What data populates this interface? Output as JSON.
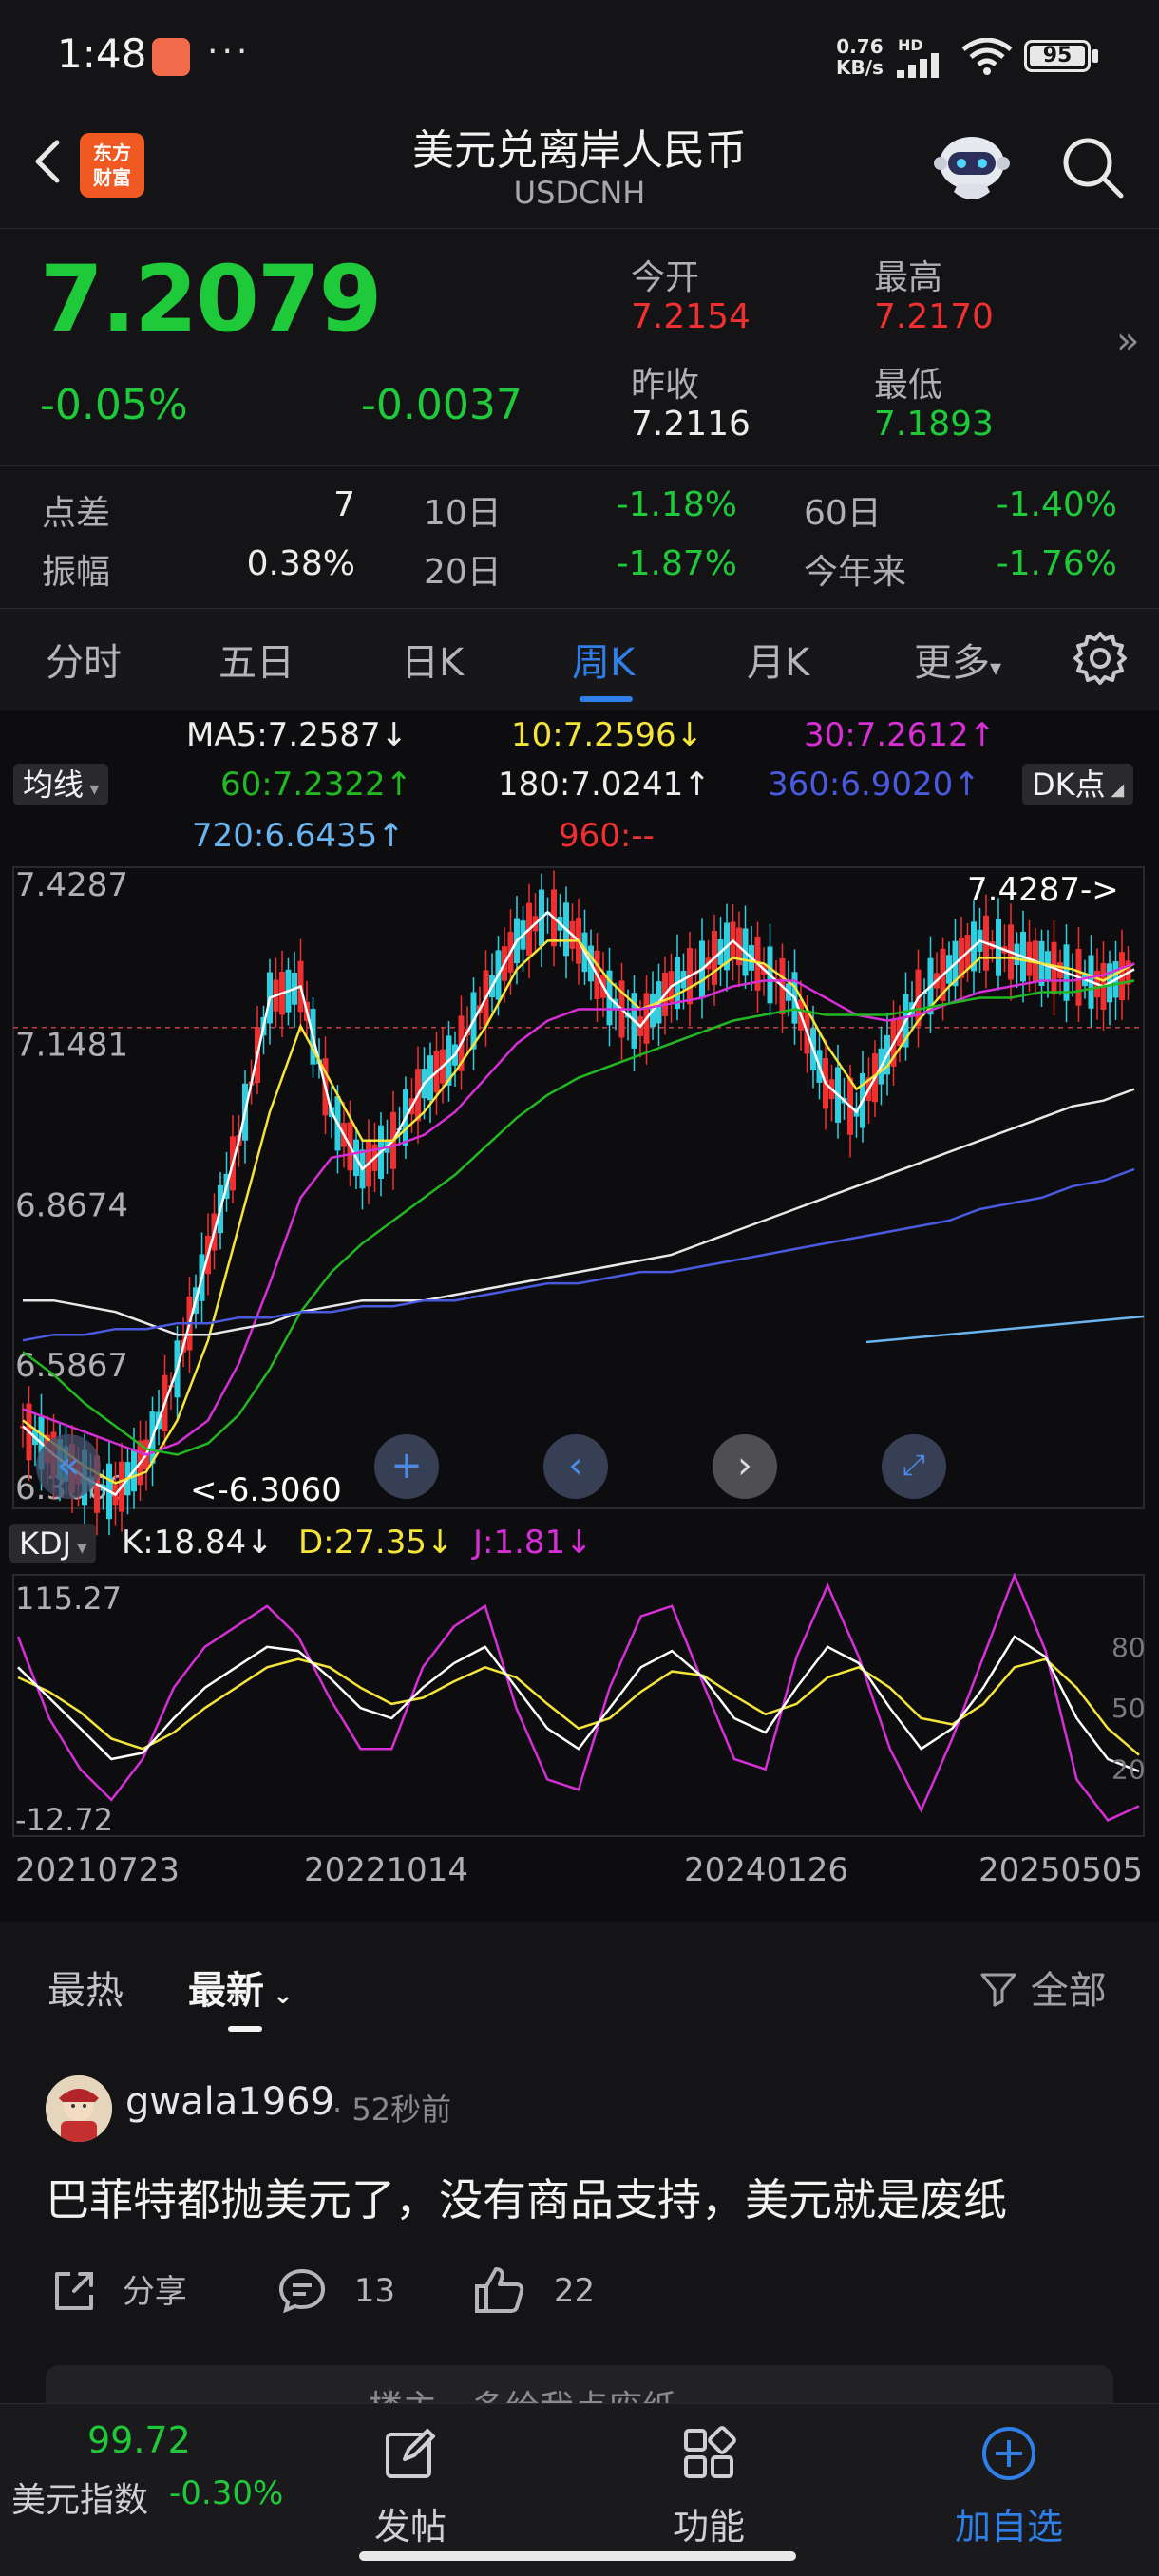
{
  "status_bar": {
    "time": "1:48",
    "dots": "···",
    "net_speed": "0.76",
    "net_unit": "KB/s",
    "hd": "HD",
    "battery": "95"
  },
  "header": {
    "logo_line1": "东方",
    "logo_line2": "财富",
    "title": "美元兑离岸人民币",
    "subtitle": "USDCNH"
  },
  "quote": {
    "price": "7.2079",
    "change_pct": "-0.05%",
    "change": "-0.0037",
    "open_label": "今开",
    "open": "7.2154",
    "high_label": "最高",
    "high": "7.2170",
    "prev_close_label": "昨收",
    "prev_close": "7.2116",
    "low_label": "最低",
    "low": "7.1893"
  },
  "stats": {
    "spread_label": "点差",
    "spread": "7",
    "amp_label": "振幅",
    "amp": "0.38%",
    "d10_label": "10日",
    "d10": "-1.18%",
    "d20_label": "20日",
    "d20": "-1.87%",
    "d60_label": "60日",
    "d60": "-1.40%",
    "ytd_label": "今年来",
    "ytd": "-1.76%"
  },
  "tabs": [
    "分时",
    "五日",
    "日K",
    "周K",
    "月K",
    "更多"
  ],
  "active_tab": "周K",
  "ma_legend": {
    "mode": "均线",
    "ma5": "MA5:7.2587↓",
    "ma10": "10:7.2596↓",
    "ma30": "30:7.2612↑",
    "ma60": "60:7.2322↑",
    "ma180": "180:7.0241↑",
    "ma360": "360:6.9020↑",
    "ma720": "720:6.6435↑",
    "ma960": "960:--",
    "dk": "DK点"
  },
  "colors": {
    "up": "#f03030",
    "down": "#1ec93a",
    "accent": "#2f7fe8",
    "ma5": "#ffffff",
    "ma10": "#f5e43a",
    "ma30": "#d62fd6",
    "ma60": "#22b822",
    "ma180": "#e8e8e8",
    "ma360": "#4a5ae0",
    "ma720": "#6ab4f0"
  },
  "chart_data": [
    {
      "type": "line",
      "subtype": "candlestick",
      "y_ticks": [
        "7.4287",
        "7.1481",
        "6.8674",
        "6.5867",
        "6.3060"
      ],
      "ylim": [
        6.306,
        7.4287
      ],
      "x_ticks": [
        "20210723",
        "20221014",
        "20240126",
        "20250505"
      ],
      "max_label": "7.4287->",
      "min_label": "<-6.3060",
      "series": [
        {
          "name": "MA5",
          "values": [
            6.45,
            6.4,
            6.36,
            6.33,
            6.4,
            6.55,
            6.75,
            6.95,
            7.2,
            7.22,
            7.0,
            6.9,
            6.95,
            7.05,
            7.1,
            7.2,
            7.3,
            7.35,
            7.3,
            7.2,
            7.15,
            7.22,
            7.25,
            7.3,
            7.25,
            7.2,
            7.05,
            7.0,
            7.1,
            7.2,
            7.25,
            7.3,
            7.28,
            7.26,
            7.24,
            7.22,
            7.25
          ]
        },
        {
          "name": "MA10",
          "values": [
            6.46,
            6.42,
            6.38,
            6.35,
            6.37,
            6.46,
            6.6,
            6.8,
            7.0,
            7.15,
            7.05,
            6.95,
            6.95,
            7.0,
            7.07,
            7.15,
            7.25,
            7.3,
            7.3,
            7.23,
            7.18,
            7.2,
            7.23,
            7.27,
            7.26,
            7.22,
            7.12,
            7.04,
            7.08,
            7.16,
            7.22,
            7.27,
            7.27,
            7.26,
            7.25,
            7.23,
            7.26
          ]
        },
        {
          "name": "MA30",
          "values": [
            6.48,
            6.46,
            6.44,
            6.42,
            6.4,
            6.42,
            6.46,
            6.56,
            6.7,
            6.85,
            6.92,
            6.93,
            6.94,
            6.96,
            7.0,
            7.06,
            7.12,
            7.16,
            7.18,
            7.18,
            7.18,
            7.19,
            7.2,
            7.22,
            7.23,
            7.23,
            7.2,
            7.17,
            7.16,
            7.17,
            7.19,
            7.21,
            7.22,
            7.23,
            7.23,
            7.24,
            7.26
          ]
        },
        {
          "name": "MA60",
          "values": [
            6.58,
            6.54,
            6.49,
            6.45,
            6.41,
            6.4,
            6.42,
            6.47,
            6.55,
            6.65,
            6.72,
            6.77,
            6.81,
            6.85,
            6.89,
            6.94,
            6.99,
            7.03,
            7.06,
            7.08,
            7.1,
            7.12,
            7.14,
            7.16,
            7.17,
            7.18,
            7.17,
            7.17,
            7.17,
            7.18,
            7.19,
            7.2,
            7.2,
            7.21,
            7.21,
            7.22,
            7.23
          ]
        },
        {
          "name": "MA180",
          "values": [
            6.67,
            6.67,
            6.66,
            6.65,
            6.63,
            6.61,
            6.61,
            6.62,
            6.63,
            6.65,
            6.66,
            6.67,
            6.67,
            6.67,
            6.68,
            6.69,
            6.7,
            6.71,
            6.72,
            6.73,
            6.74,
            6.75,
            6.77,
            6.79,
            6.81,
            6.83,
            6.85,
            6.87,
            6.89,
            6.91,
            6.93,
            6.95,
            6.97,
            6.99,
            7.01,
            7.02,
            7.04
          ]
        },
        {
          "name": "MA360",
          "values": [
            6.6,
            6.61,
            6.61,
            6.62,
            6.62,
            6.63,
            6.63,
            6.64,
            6.64,
            6.65,
            6.65,
            6.66,
            6.66,
            6.67,
            6.67,
            6.68,
            6.69,
            6.7,
            6.7,
            6.71,
            6.72,
            6.72,
            6.73,
            6.74,
            6.75,
            6.76,
            6.77,
            6.78,
            6.79,
            6.8,
            6.81,
            6.83,
            6.84,
            6.85,
            6.87,
            6.88,
            6.9
          ]
        }
      ]
    },
    {
      "type": "line",
      "title": "KDJ",
      "k_label": "K:18.84↓",
      "d_label": "D:27.35↓",
      "j_label": "J:1.81↓",
      "y_top_label": "115.27",
      "y_bottom_label": "-12.72",
      "ylim": [
        -12.72,
        115.27
      ],
      "right_ticks": [
        "80",
        "50",
        "20"
      ],
      "series": [
        {
          "name": "K",
          "values": [
            70,
            55,
            40,
            25,
            28,
            45,
            60,
            70,
            80,
            78,
            65,
            50,
            45,
            60,
            72,
            80,
            60,
            40,
            30,
            50,
            70,
            78,
            65,
            45,
            38,
            60,
            80,
            72,
            50,
            30,
            40,
            60,
            85,
            75,
            45,
            25,
            19
          ]
        },
        {
          "name": "D",
          "values": [
            65,
            58,
            48,
            35,
            30,
            38,
            50,
            60,
            70,
            74,
            70,
            60,
            52,
            55,
            63,
            70,
            65,
            52,
            40,
            45,
            58,
            68,
            66,
            56,
            47,
            52,
            65,
            70,
            60,
            45,
            42,
            52,
            70,
            74,
            60,
            40,
            27
          ]
        },
        {
          "name": "J",
          "values": [
            85,
            45,
            20,
            5,
            25,
            60,
            80,
            90,
            100,
            85,
            55,
            30,
            30,
            70,
            90,
            100,
            50,
            15,
            10,
            60,
            95,
            100,
            62,
            25,
            20,
            75,
            110,
            75,
            30,
            0,
            35,
            75,
            115,
            78,
            15,
            -5,
            2
          ]
        }
      ]
    }
  ],
  "feed": {
    "tab_hot": "最热",
    "tab_new": "最新",
    "filter": "全部"
  },
  "post": {
    "user": "gwala1969",
    "time": "· 52秒前",
    "text": "巴菲特都抛美元了，没有商品支持，美元就是废纸",
    "share": "分享",
    "comments": "13",
    "likes": "22",
    "quote_preview": "楼主，多给我点废纸"
  },
  "bottom_nav": {
    "index_value": "99.72",
    "index_name": "美元指数",
    "index_pct": "-0.30%",
    "post": "发帖",
    "func": "功能",
    "add": "加自选"
  }
}
